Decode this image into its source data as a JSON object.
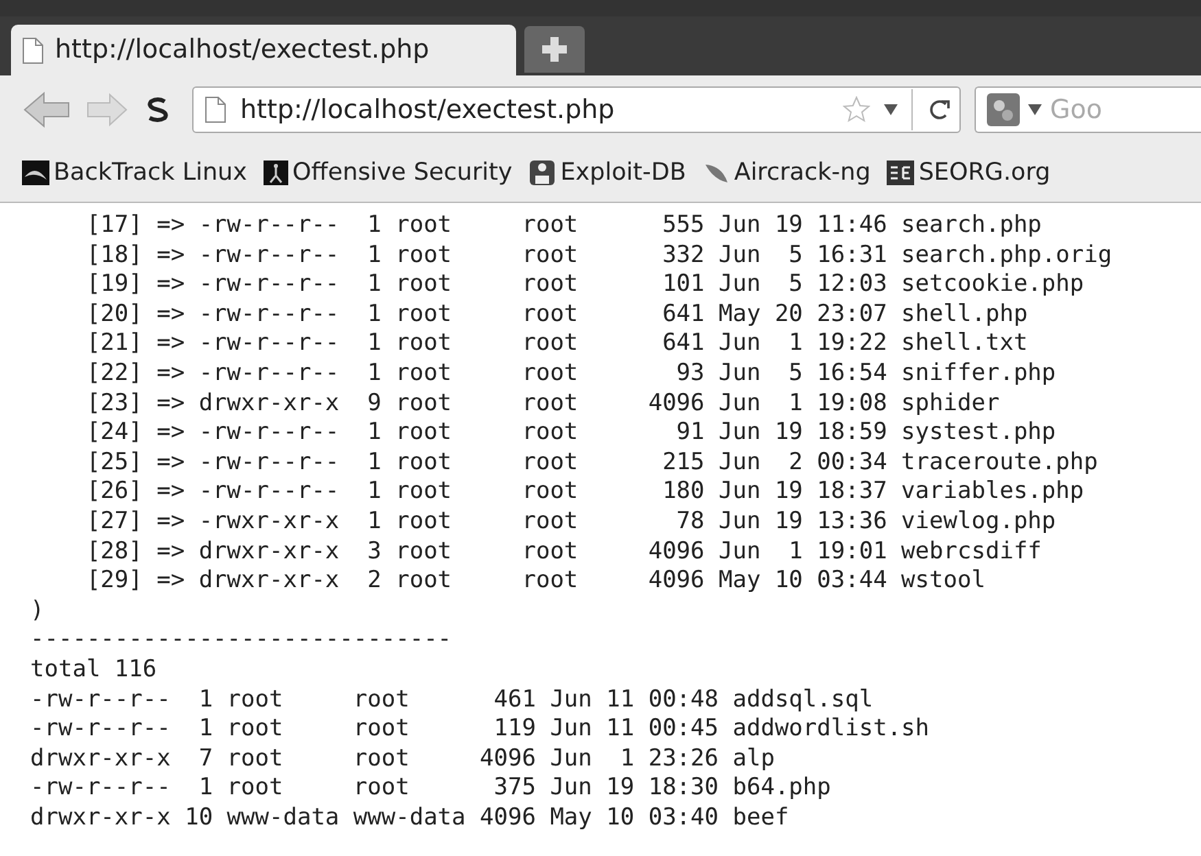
{
  "tabs": [
    {
      "title": "http://localhost/exectest.php",
      "selected": true
    }
  ],
  "address_bar": {
    "url": "http://localhost/exectest.php"
  },
  "search": {
    "placeholder": "Goo"
  },
  "bookmarks": [
    "BackTrack Linux",
    "Offensive Security",
    "Exploit-DB",
    "Aircrack-ng",
    "SEORG.org"
  ],
  "content_lines": [
    "    [17] => -rw-r--r--  1 root     root      555 Jun 19 11:46 search.php",
    "    [18] => -rw-r--r--  1 root     root      332 Jun  5 16:31 search.php.orig",
    "    [19] => -rw-r--r--  1 root     root      101 Jun  5 12:03 setcookie.php",
    "    [20] => -rw-r--r--  1 root     root      641 May 20 23:07 shell.php",
    "    [21] => -rw-r--r--  1 root     root      641 Jun  1 19:22 shell.txt",
    "    [22] => -rw-r--r--  1 root     root       93 Jun  5 16:54 sniffer.php",
    "    [23] => drwxr-xr-x  9 root     root     4096 Jun  1 19:08 sphider",
    "    [24] => -rw-r--r--  1 root     root       91 Jun 19 18:59 systest.php",
    "    [25] => -rw-r--r--  1 root     root      215 Jun  2 00:34 traceroute.php",
    "    [26] => -rw-r--r--  1 root     root      180 Jun 19 18:37 variables.php",
    "    [27] => -rwxr-xr-x  1 root     root       78 Jun 19 13:36 viewlog.php",
    "    [28] => drwxr-xr-x  3 root     root     4096 Jun  1 19:01 webrcsdiff",
    "    [29] => drwxr-xr-x  2 root     root     4096 May 10 03:44 wstool",
    ")",
    "------------------------------",
    "total 116",
    "-rw-r--r--  1 root     root      461 Jun 11 00:48 addsql.sql",
    "-rw-r--r--  1 root     root      119 Jun 11 00:45 addwordlist.sh",
    "drwxr-xr-x  7 root     root     4096 Jun  1 23:26 alp",
    "-rw-r--r--  1 root     root      375 Jun 19 18:30 b64.php",
    "drwxr-xr-x 10 www-data www-data 4096 May 10 03:40 beef"
  ]
}
